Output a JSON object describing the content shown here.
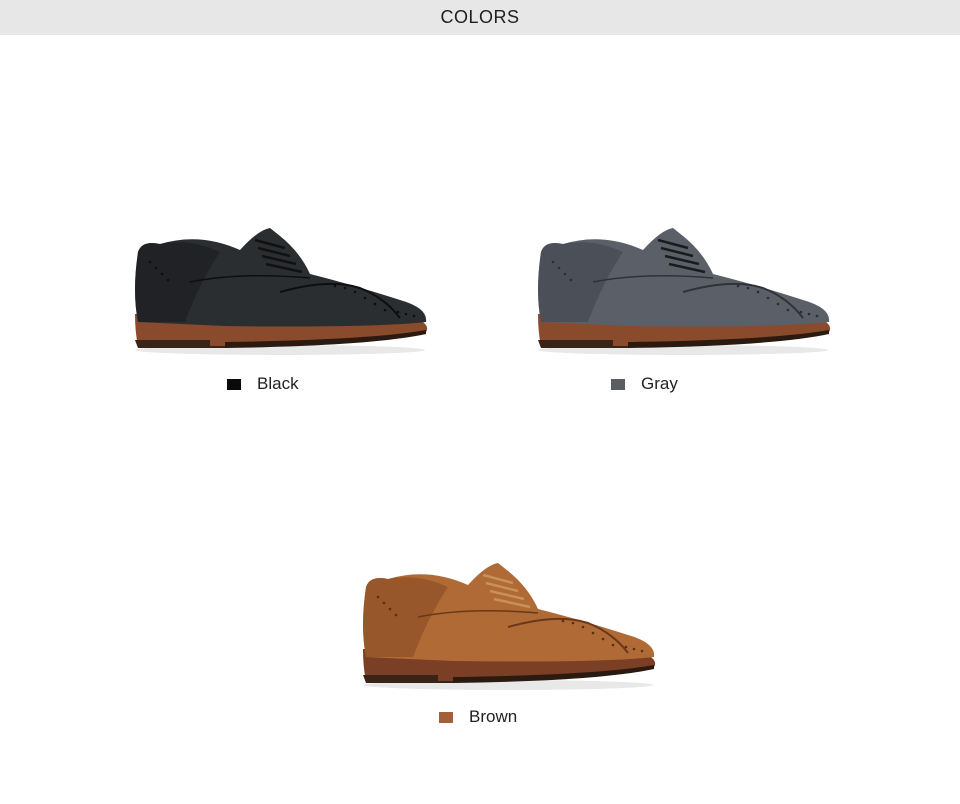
{
  "header": {
    "title": "COLORS"
  },
  "colors": [
    {
      "name": "Black",
      "swatch": "#0a0a0a",
      "upper": "#2b2e31",
      "upper_dark": "#17191b",
      "sole": "#8a4a2c",
      "icon": "wingtip-oxford-shoe-icon"
    },
    {
      "name": "Gray",
      "swatch": "#5a5d62",
      "upper": "#5b6068",
      "upper_dark": "#3e424a",
      "sole": "#8a4a2c",
      "icon": "wingtip-oxford-shoe-icon"
    },
    {
      "name": "Brown",
      "swatch": "#a0603a",
      "upper": "#b06a36",
      "upper_dark": "#7e4420",
      "sole": "#7a3f24",
      "icon": "wingtip-oxford-shoe-icon"
    }
  ]
}
